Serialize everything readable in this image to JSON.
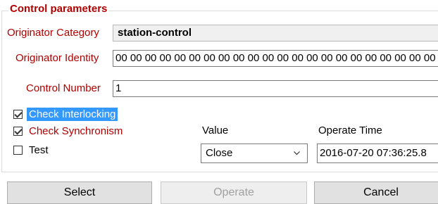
{
  "group": {
    "title": "Control parameters"
  },
  "originator_category": {
    "label": "Originator Category",
    "value": "station-control"
  },
  "originator_identity": {
    "label": "Originator Identity",
    "value": "00 00 00 00 00 00 00 00 00 00 00 00 00 00 00 00 00 00 00 00 00 00"
  },
  "control_number": {
    "label": "Control Number",
    "value": "1"
  },
  "checks": {
    "interlocking": {
      "label": "Check Interlocking",
      "checked": true
    },
    "synchronism": {
      "label": "Check Synchronism",
      "checked": true
    },
    "test": {
      "label": "Test",
      "checked": false
    }
  },
  "value": {
    "label": "Value",
    "selected": "Close"
  },
  "operate_time": {
    "label": "Operate Time",
    "value": "2016-07-20 07:36:25.8"
  },
  "buttons": {
    "select": "Select",
    "operate": "Operate",
    "cancel": "Cancel"
  }
}
